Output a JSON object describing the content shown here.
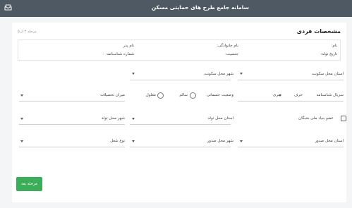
{
  "app": {
    "title": "سامانه جامع طرح های حمایتی مسکن"
  },
  "section": {
    "title": "مشخصات فردی",
    "step": "مرحله ۲ از ۵"
  },
  "info": {
    "name": "نام:",
    "family": "نام خانوادگی:",
    "father": "نام پدر",
    "birth_date": "تاریخ تولد:",
    "gender": "جنسیت:",
    "id_number": "شماره شناسنامه: ۰"
  },
  "fields": {
    "residence_province": "استان محل سکونت",
    "residence_city": "شهر محل سکونت",
    "id_serial": "سریال شناسنامه",
    "letter": "حرف",
    "series": "سری",
    "physical_status": "وضعیت جسمانی",
    "healthy": "سالم",
    "disabled": "معلول",
    "education": "میزان تحصیلات",
    "basij_member": "عضو بنیاد ملی نخبگان",
    "birth_province": "استان محل تولد",
    "birth_city": "شهر محل تولد",
    "issue_province": "استان محل صدور",
    "issue_city": "شهر محل صدور",
    "job_type": "نوع شغل"
  },
  "buttons": {
    "next": "مرحله بعد"
  }
}
